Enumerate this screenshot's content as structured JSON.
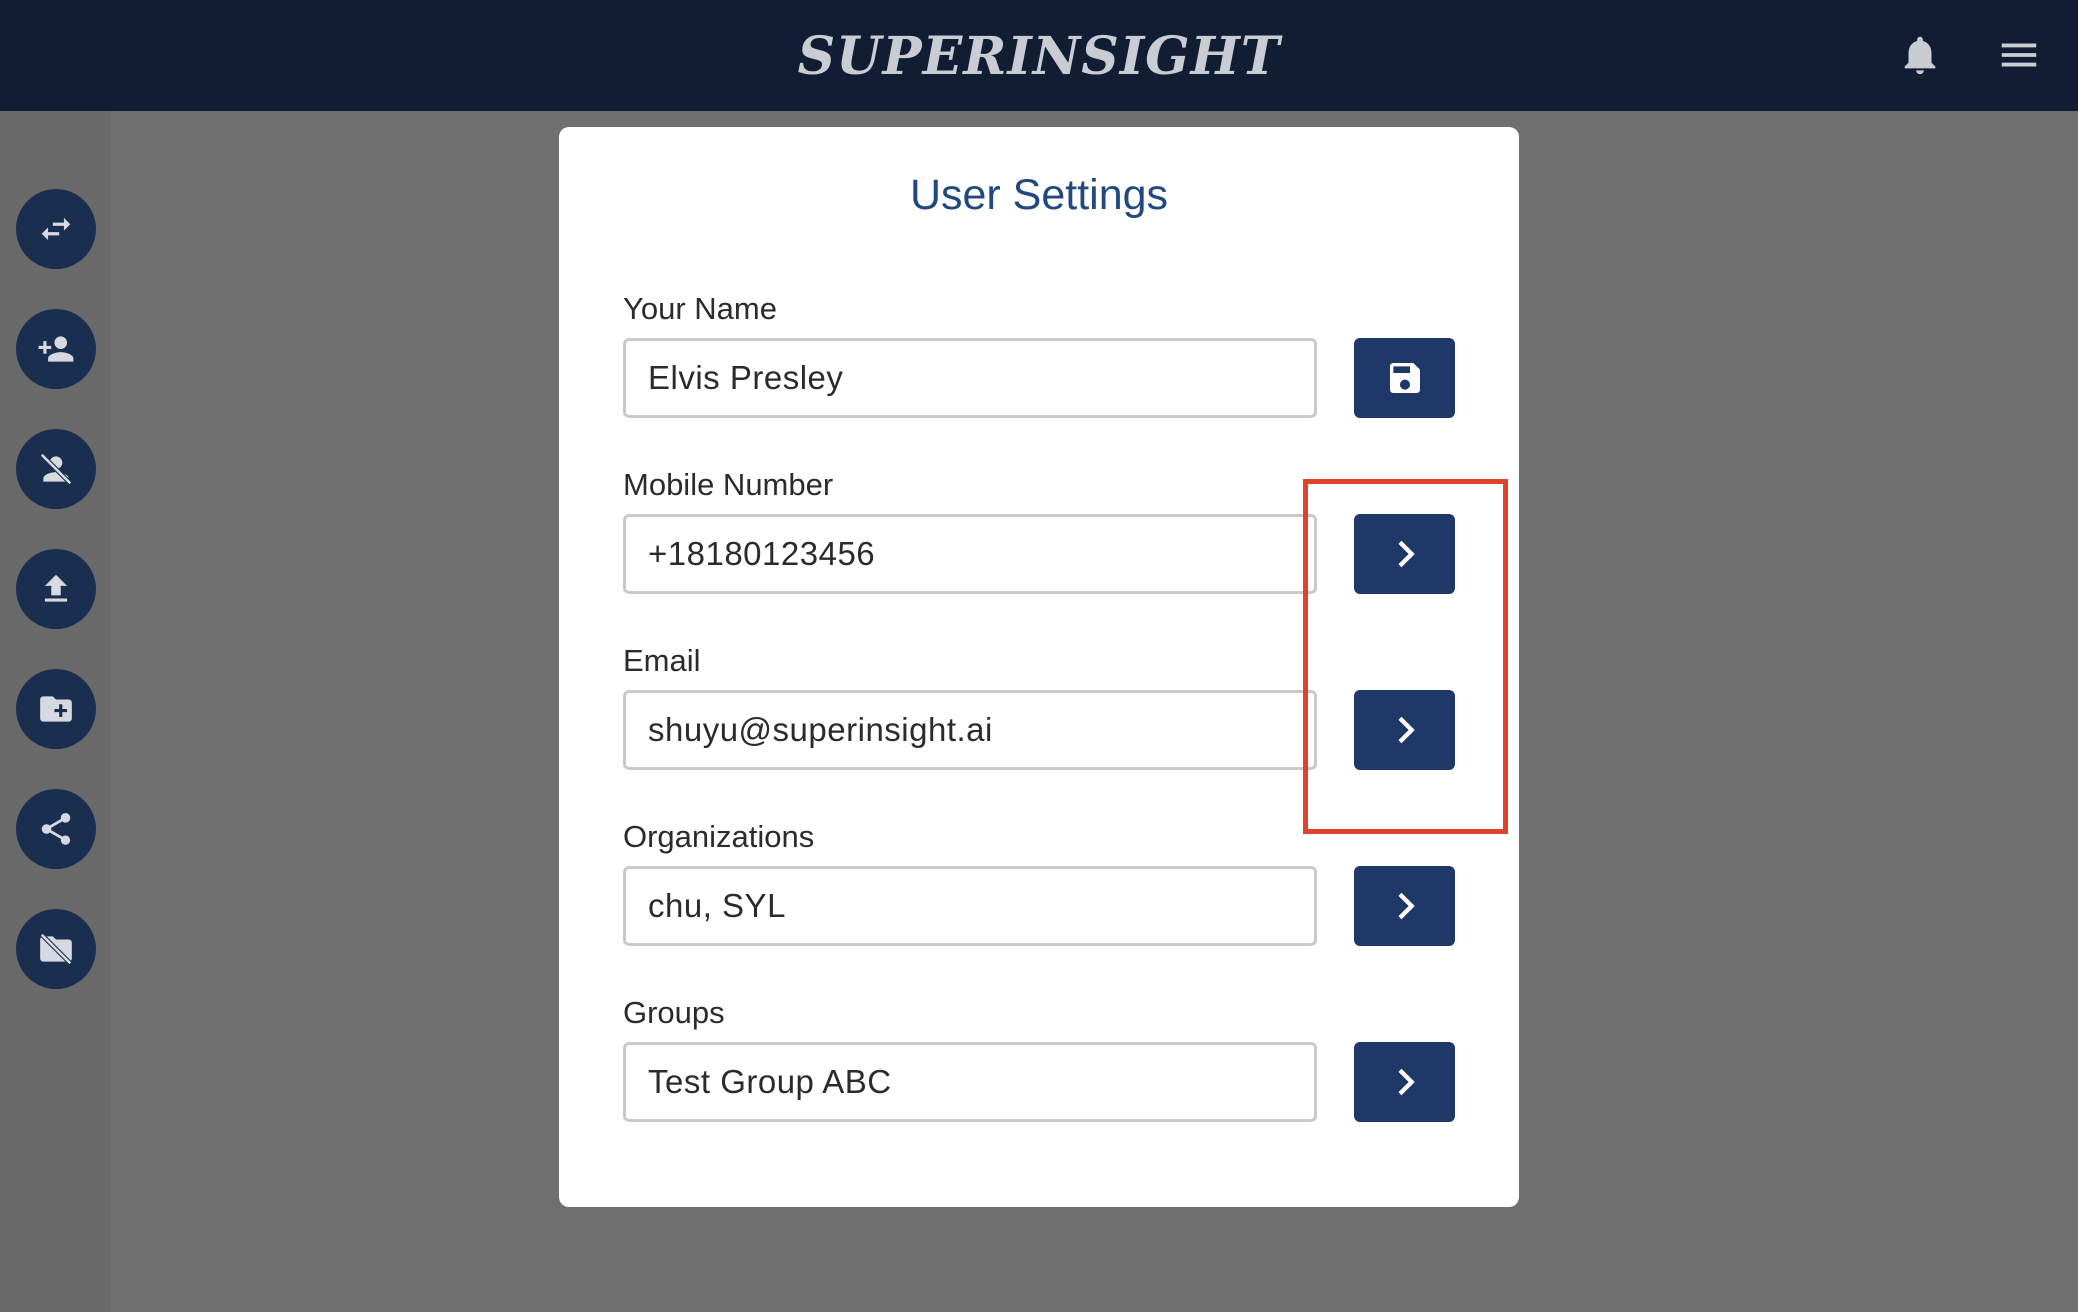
{
  "header": {
    "brand": "SUPERINSIGHT",
    "icons": [
      "bell-icon",
      "menu-icon"
    ]
  },
  "sidebar": {
    "buttons": [
      {
        "name": "swap-icon"
      },
      {
        "name": "add-user-icon"
      },
      {
        "name": "remove-user-icon"
      },
      {
        "name": "upload-icon"
      },
      {
        "name": "add-folder-icon"
      },
      {
        "name": "share-icon"
      },
      {
        "name": "hide-folder-icon"
      }
    ]
  },
  "modal": {
    "title": "User Settings",
    "fields": [
      {
        "label": "Your Name",
        "value": "Elvis Presley",
        "button_icon": "save-icon"
      },
      {
        "label": "Mobile Number",
        "value": "+18180123456",
        "button_icon": "chevron-right-icon"
      },
      {
        "label": "Email",
        "value": "shuyu@superinsight.ai",
        "button_icon": "chevron-right-icon"
      },
      {
        "label": "Organizations",
        "value": "chu, SYL",
        "button_icon": "chevron-right-icon"
      },
      {
        "label": "Groups",
        "value": "Test Group ABC",
        "button_icon": "chevron-right-icon"
      }
    ]
  },
  "colors": {
    "topbar": "#111d33",
    "accent": "#1e3868",
    "title": "#23487e",
    "highlight": "#e2412c",
    "overlay": "#6f6f6f"
  }
}
